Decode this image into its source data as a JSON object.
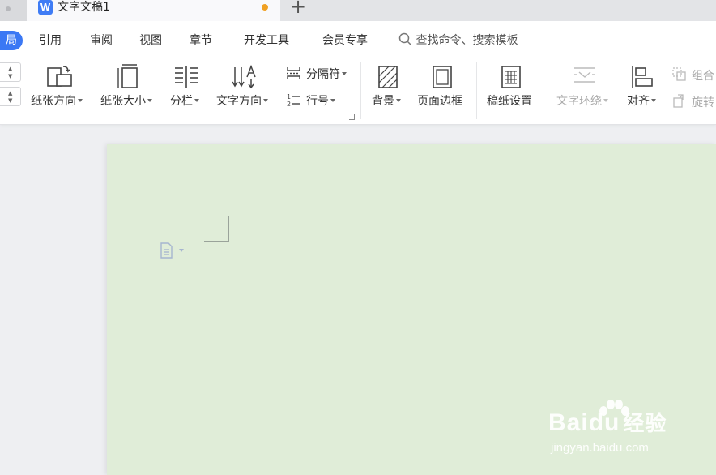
{
  "tabbar": {
    "doc_icon_letter": "W",
    "tab_title": "文字文稿1",
    "new_tab_label": "+",
    "accent_color": "#3f7cf5",
    "unsaved_color": "#f0a123"
  },
  "menu": {
    "active_fragment": "局",
    "items": [
      "引用",
      "审阅",
      "视图",
      "章节",
      "开发工具",
      "会员专享"
    ],
    "search_text": "查找命令、搜索模板",
    "active_color": "#3b78f4"
  },
  "ribbon": {
    "spinner_up": "▲",
    "spinner_down": "▼",
    "orientation": "纸张方向",
    "size": "纸张大小",
    "columns": "分栏",
    "text_direction": "文字方向",
    "breaks": "分隔符",
    "line_numbers": "行号",
    "background": "背景",
    "page_borders": "页面边框",
    "manuscript": "稿纸设置",
    "text_wrap": "文字环绕",
    "align": "对齐",
    "group": "组合",
    "rotate": "旋转"
  },
  "document": {
    "page_color": "#e0edd8"
  },
  "watermark": {
    "brand": "Bai",
    "brand_tail": "du",
    "brand_cn": "经验",
    "url": "jingyan.baidu.com"
  }
}
